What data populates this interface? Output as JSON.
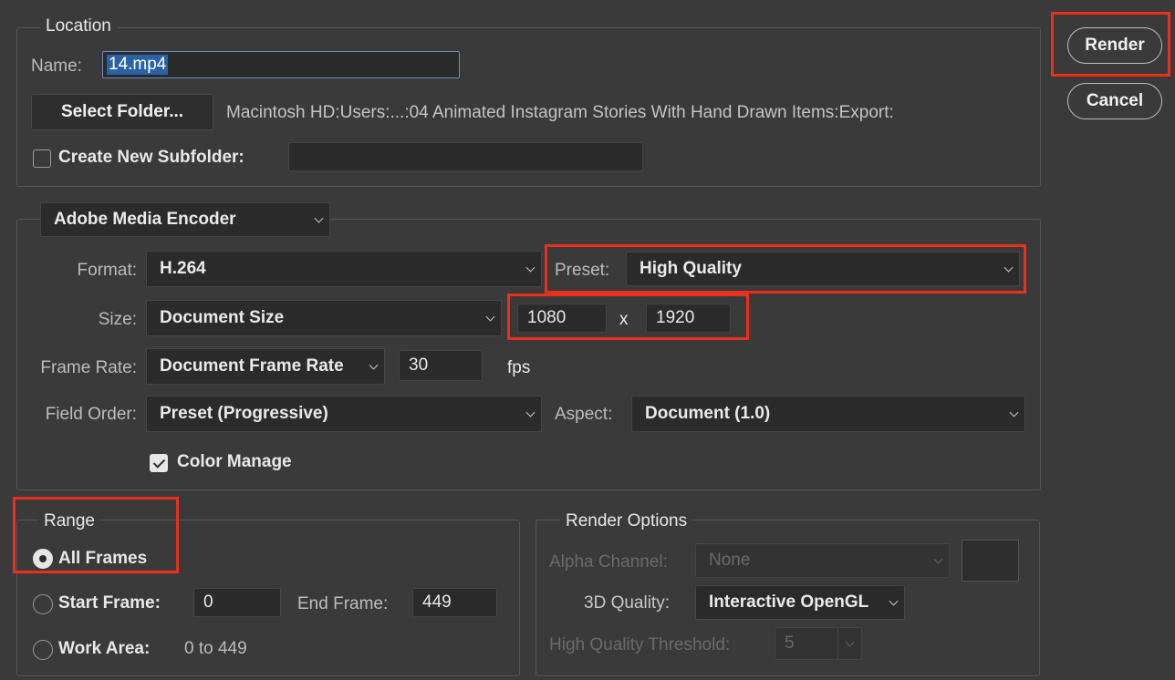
{
  "location": {
    "legend": "Location",
    "name_label": "Name:",
    "name_value": "14.mp4",
    "select_folder_label": "Select Folder...",
    "folder_path": "Macintosh HD:Users:...:04 Animated Instagram Stories With Hand Drawn Items:Export:",
    "subfolder_label": "Create New Subfolder:",
    "subfolder_checked": false,
    "subfolder_value": ""
  },
  "actions": {
    "render_label": "Render",
    "cancel_label": "Cancel"
  },
  "encoder": {
    "renderer": "Adobe Media Encoder",
    "format_label": "Format:",
    "format_value": "H.264",
    "preset_label": "Preset:",
    "preset_value": "High Quality",
    "size_label": "Size:",
    "size_value": "Document Size",
    "width_value": "1080",
    "size_x": "x",
    "height_value": "1920",
    "frame_rate_label": "Frame Rate:",
    "frame_rate_value": "Document Frame Rate",
    "fps_value": "30",
    "fps_unit": "fps",
    "field_order_label": "Field Order:",
    "field_order_value": "Preset (Progressive)",
    "aspect_label": "Aspect:",
    "aspect_value": "Document (1.0)",
    "color_manage_label": "Color Manage",
    "color_manage_checked": true
  },
  "range": {
    "legend": "Range",
    "all_frames_label": "All Frames",
    "start_frame_label": "Start Frame:",
    "start_frame_value": "0",
    "end_frame_label": "End Frame:",
    "end_frame_value": "449",
    "work_area_label": "Work Area:",
    "work_area_value": "0 to 449",
    "selected": "All Frames"
  },
  "render_options": {
    "legend": "Render Options",
    "alpha_label": "Alpha Channel:",
    "alpha_value": "None",
    "quality_label": "3D Quality:",
    "quality_value": "Interactive OpenGL",
    "threshold_label": "High Quality Threshold:",
    "threshold_value": "5"
  },
  "colors": {
    "highlight": "#e8301c",
    "text_selection": "#2a62a6",
    "background": "#3a3a3a"
  }
}
